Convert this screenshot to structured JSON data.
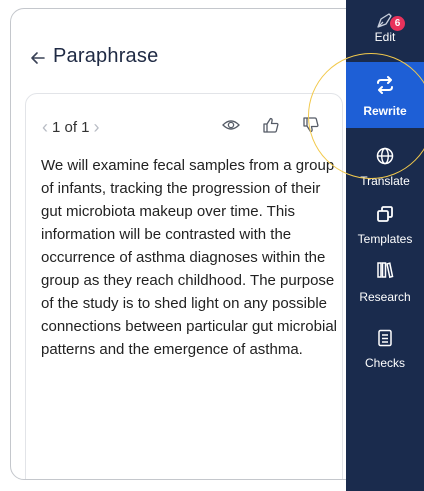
{
  "panel": {
    "title": "Paraphrase",
    "back_icon": "arrow-left-icon",
    "pager": {
      "prev_icon": "chevron-left-icon",
      "count": "1 of 1",
      "next_icon": "chevron-right-icon"
    },
    "actions": [
      {
        "icon": "eye-icon"
      },
      {
        "icon": "thumbs-up-icon"
      },
      {
        "icon": "thumbs-down-icon"
      }
    ],
    "text": "We will examine fecal samples from a group of infants, tracking the progression of their gut microbiota makeup over time. This information will be contrasted with the occurrence of asthma diagnoses within the group as they reach childhood. The purpose of the study is to shed light on any possible connections between particular gut microbial patterns and the emergence of asthma."
  },
  "sidebar": {
    "edit": {
      "label": "Edit",
      "icon": "pen-nib-icon",
      "badge": "6"
    },
    "rewrite": {
      "label": "Rewrite",
      "icon": "repeat-icon",
      "active": true
    },
    "translate": {
      "label": "Translate",
      "icon": "globe-icon"
    },
    "templates": {
      "label": "Templates",
      "icon": "copy-icon"
    },
    "research": {
      "label": "Research",
      "icon": "books-icon"
    },
    "checks": {
      "label": "Checks",
      "icon": "checklist-icon"
    }
  },
  "colors": {
    "sidebar_bg": "#1a2b4d",
    "active_bg": "#1e5fd6",
    "badge": "#e8325b",
    "highlight_ring": "#f2c94c"
  }
}
